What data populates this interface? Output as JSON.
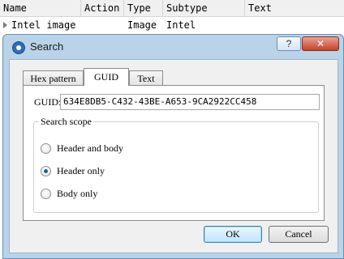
{
  "table": {
    "columns": [
      "Name",
      "Action",
      "Type",
      "Subtype",
      "Text"
    ],
    "rows": [
      {
        "name": "Intel image",
        "action": "",
        "type": "Image",
        "subtype": "Intel",
        "text": ""
      }
    ]
  },
  "dialog": {
    "title": "Search",
    "help_label": "?",
    "close_label": "✕",
    "tabs": [
      "Hex pattern",
      "GUID",
      "Text"
    ],
    "active_tab": "GUID",
    "guid": {
      "label": "GUID:",
      "value": "634E8DB5-C432-43BE-A653-9CA2922CC458"
    },
    "scope": {
      "title": "Search scope",
      "options": [
        "Header and body",
        "Header only",
        "Body only"
      ],
      "selected": "Header only"
    },
    "buttons": {
      "ok": "OK",
      "cancel": "Cancel"
    }
  },
  "colors": {
    "dialog_frame": "#b9d3e9",
    "close_button": "#c4412a",
    "radio_dot": "#1f5fa8"
  }
}
